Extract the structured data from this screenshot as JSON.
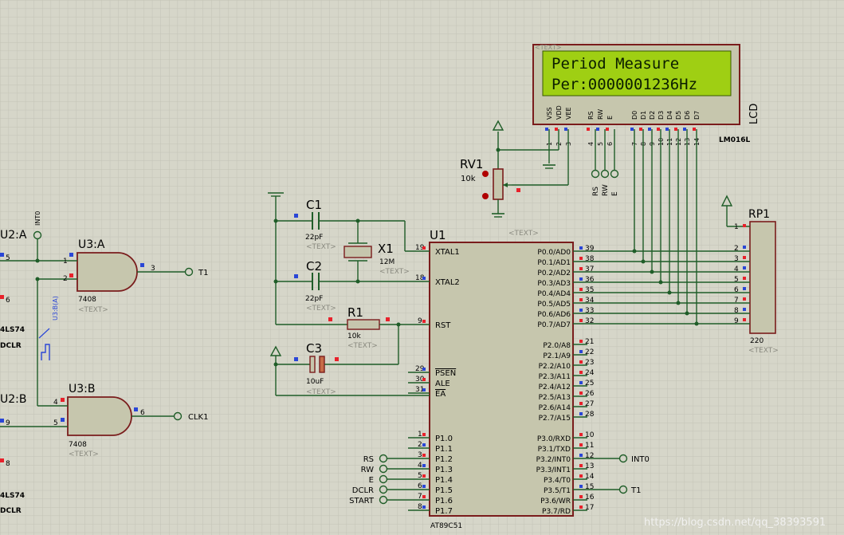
{
  "lcd": {
    "line1": "Period Measure",
    "line2": "Per:0000001236Hz",
    "ref": "LCD",
    "model": "LM016L",
    "text_tag": "<TEXT>",
    "pins": [
      "VSS",
      "VDD",
      "VEE",
      "RS",
      "RW",
      "E",
      "D0",
      "D1",
      "D2",
      "D3",
      "D4",
      "D5",
      "D6",
      "D7"
    ],
    "pin_numbers": [
      "1",
      "2",
      "3",
      "4",
      "5",
      "6",
      "7",
      "8",
      "9",
      "10",
      "11",
      "12",
      "13",
      "14"
    ],
    "ctrl_labels": [
      "RS",
      "RW",
      "E"
    ]
  },
  "u1": {
    "ref": "U1",
    "model": "AT89C51",
    "left_pins": [
      {
        "num": "19",
        "name": "XTAL1"
      },
      {
        "num": "18",
        "name": "XTAL2"
      },
      {
        "num": "9",
        "name": "RST"
      },
      {
        "num": "29",
        "name": "PSEN"
      },
      {
        "num": "30",
        "name": "ALE"
      },
      {
        "num": "31",
        "name": "EA"
      },
      {
        "num": "1",
        "name": "P1.0"
      },
      {
        "num": "2",
        "name": "P1.1"
      },
      {
        "num": "3",
        "name": "P1.2"
      },
      {
        "num": "4",
        "name": "P1.3"
      },
      {
        "num": "5",
        "name": "P1.4"
      },
      {
        "num": "6",
        "name": "P1.5"
      },
      {
        "num": "7",
        "name": "P1.6"
      },
      {
        "num": "8",
        "name": "P1.7"
      }
    ],
    "right_pins": [
      {
        "num": "39",
        "name": "P0.0/AD0"
      },
      {
        "num": "38",
        "name": "P0.1/AD1"
      },
      {
        "num": "37",
        "name": "P0.2/AD2"
      },
      {
        "num": "36",
        "name": "P0.3/AD3"
      },
      {
        "num": "35",
        "name": "P0.4/AD4"
      },
      {
        "num": "34",
        "name": "P0.5/AD5"
      },
      {
        "num": "33",
        "name": "P0.6/AD6"
      },
      {
        "num": "32",
        "name": "P0.7/AD7"
      },
      {
        "num": "21",
        "name": "P2.0/A8"
      },
      {
        "num": "22",
        "name": "P2.1/A9"
      },
      {
        "num": "23",
        "name": "P2.2/A10"
      },
      {
        "num": "24",
        "name": "P2.3/A11"
      },
      {
        "num": "25",
        "name": "P2.4/A12"
      },
      {
        "num": "26",
        "name": "P2.5/A13"
      },
      {
        "num": "27",
        "name": "P2.6/A14"
      },
      {
        "num": "28",
        "name": "P2.7/A15"
      },
      {
        "num": "10",
        "name": "P3.0/RXD"
      },
      {
        "num": "11",
        "name": "P3.1/TXD"
      },
      {
        "num": "12",
        "name": "P3.2/INT0"
      },
      {
        "num": "13",
        "name": "P3.3/INT1"
      },
      {
        "num": "14",
        "name": "P3.4/T0"
      },
      {
        "num": "15",
        "name": "P3.5/T1"
      },
      {
        "num": "16",
        "name": "P3.6/WR"
      },
      {
        "num": "17",
        "name": "P3.7/RD"
      }
    ],
    "p1_net_labels": [
      "RS",
      "RW",
      "E",
      "DCLR",
      "START"
    ],
    "int0_label": "INT0",
    "t1_label": "T1"
  },
  "rv1": {
    "ref": "RV1",
    "value": "10k",
    "text_tag": "<TEXT>"
  },
  "c1": {
    "ref": "C1",
    "value": "22pF",
    "text_tag": "<TEXT>"
  },
  "c2": {
    "ref": "C2",
    "value": "22pF",
    "text_tag": "<TEXT>"
  },
  "c3": {
    "ref": "C3",
    "value": "10uF",
    "text_tag": "<TEXT>"
  },
  "r1": {
    "ref": "R1",
    "value": "10k",
    "text_tag": "<TEXT>"
  },
  "x1": {
    "ref": "X1",
    "value": "12M",
    "text_tag": "<TEXT>"
  },
  "rp1": {
    "ref": "RP1",
    "value": "220",
    "text_tag": "<TEXT>",
    "pins": [
      "1",
      "2",
      "3",
      "4",
      "5",
      "6",
      "7",
      "8",
      "9"
    ]
  },
  "u3a": {
    "ref": "U3:A",
    "model": "7408",
    "text_tag": "<TEXT>",
    "pin_in1": "1",
    "pin_in2": "2",
    "pin_out": "3",
    "out_label": "T1"
  },
  "u3b": {
    "ref": "U3:B",
    "model": "7408",
    "text_tag": "<TEXT>",
    "pin_in1": "4",
    "pin_in2": "5",
    "pin_out": "6",
    "out_label": "CLK1"
  },
  "left_parts": {
    "u2a": "U2:A",
    "u2b": "U2:B",
    "int0": "INT0",
    "pin5": "5",
    "pin6": "6",
    "pin9": "9",
    "pin8": "8",
    "ls74_a": "4LS74",
    "dclr_a": "DCLR",
    "ls74_b": "4LS74",
    "dclr_b": "DCLR",
    "gen_label": "U3:B(A)"
  },
  "watermark": "https://blog.csdn.net/qq_38393591",
  "colors": {
    "background": "#d6d6c9",
    "grid": "#c4c4b6",
    "wire": "#1f5d28",
    "body_fill": "#c6c6ad",
    "body_stroke": "#7a1c1c",
    "lcd_screen": "#9fcf13",
    "pin_red": "#e8212b",
    "pin_blue": "#2a46d6"
  }
}
